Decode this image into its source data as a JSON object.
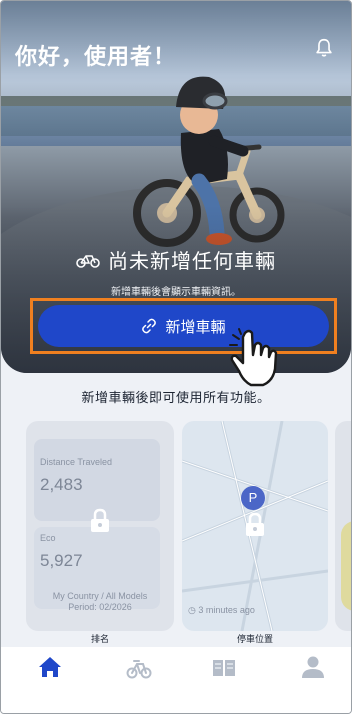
{
  "header": {
    "greeting": "你好，使用者！",
    "notification_icon": "bell-icon"
  },
  "hero": {
    "empty_title": "尚未新增任何車輛",
    "empty_subtitle": "新增車輛後會顯示車輛資訊。",
    "add_button_label": "新增車輛",
    "add_button_icon": "link-icon",
    "empty_icon": "bicycle-icon"
  },
  "info_text": "新增車輛後即可使用所有功能。",
  "cards": [
    {
      "label": "排名",
      "distance_label": "Distance Traveled",
      "distance_value": "2,483",
      "eco_label": "Eco",
      "eco_value": "5,927",
      "footer_line1": "My Country / All Models",
      "footer_line2": "Period: 02/2026"
    },
    {
      "label": "停車位置",
      "pin_letter": "P",
      "time_text": "3 minutes ago"
    },
    {
      "label": ""
    }
  ],
  "nav": {
    "items": [
      {
        "icon": "home-icon",
        "active": true
      },
      {
        "icon": "scooter-icon",
        "active": false
      },
      {
        "icon": "book-icon",
        "active": false
      },
      {
        "icon": "profile-icon",
        "active": false
      }
    ]
  },
  "colors": {
    "accent": "#1f47c9",
    "highlight": "#f08020",
    "nav_active": "#1f47c9",
    "nav_inactive": "#b4bcc8"
  }
}
